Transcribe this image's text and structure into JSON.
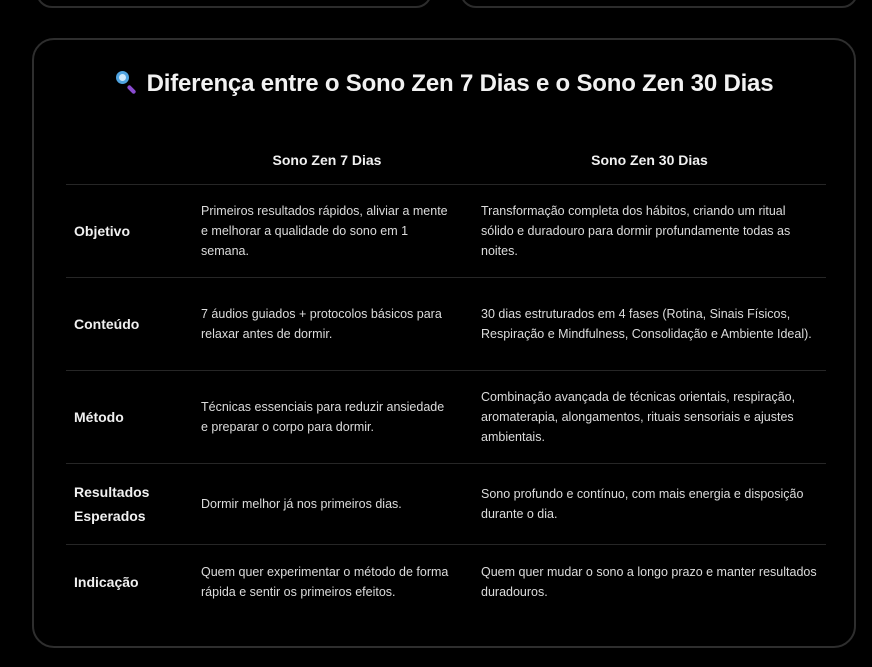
{
  "title": "Diferença entre o Sono Zen 7 Dias e o Sono Zen 30 Dias",
  "title_icon": "magnifying-glass-icon",
  "table": {
    "headers": [
      "",
      "Sono Zen 7 Dias",
      "Sono Zen 30 Dias"
    ],
    "rows": [
      {
        "label": "Objetivo",
        "seven": "Primeiros resultados rápidos, aliviar a mente e melhorar a qualidade do sono em 1 semana.",
        "thirty": "Transformação completa dos hábitos, criando um ritual sólido e duradouro para dormir profundamente todas as noites."
      },
      {
        "label": "Conteúdo",
        "seven": "7 áudios guiados + protocolos básicos para relaxar antes de dormir.",
        "thirty": "30 dias estruturados em 4 fases (Rotina, Sinais Físicos, Respiração e Mindfulness, Consolidação e Ambiente Ideal)."
      },
      {
        "label": "Método",
        "seven": "Técnicas essenciais para reduzir ansiedade e preparar o corpo para dormir.",
        "thirty": "Combinação avançada de técnicas orientais, respiração, aromaterapia, alongamentos, rituais sensoriais e ajustes ambientais."
      },
      {
        "label": "Resultados Esperados",
        "seven": "Dormir melhor já nos primeiros dias.",
        "thirty": "Sono profundo e contínuo, com mais energia e disposição durante o dia."
      },
      {
        "label": "Indicação",
        "seven": "Quem quer experimentar o método de forma rápida e sentir os primeiros efeitos.",
        "thirty": "Quem quer mudar o sono a longo prazo e manter resultados duradouros."
      }
    ]
  }
}
